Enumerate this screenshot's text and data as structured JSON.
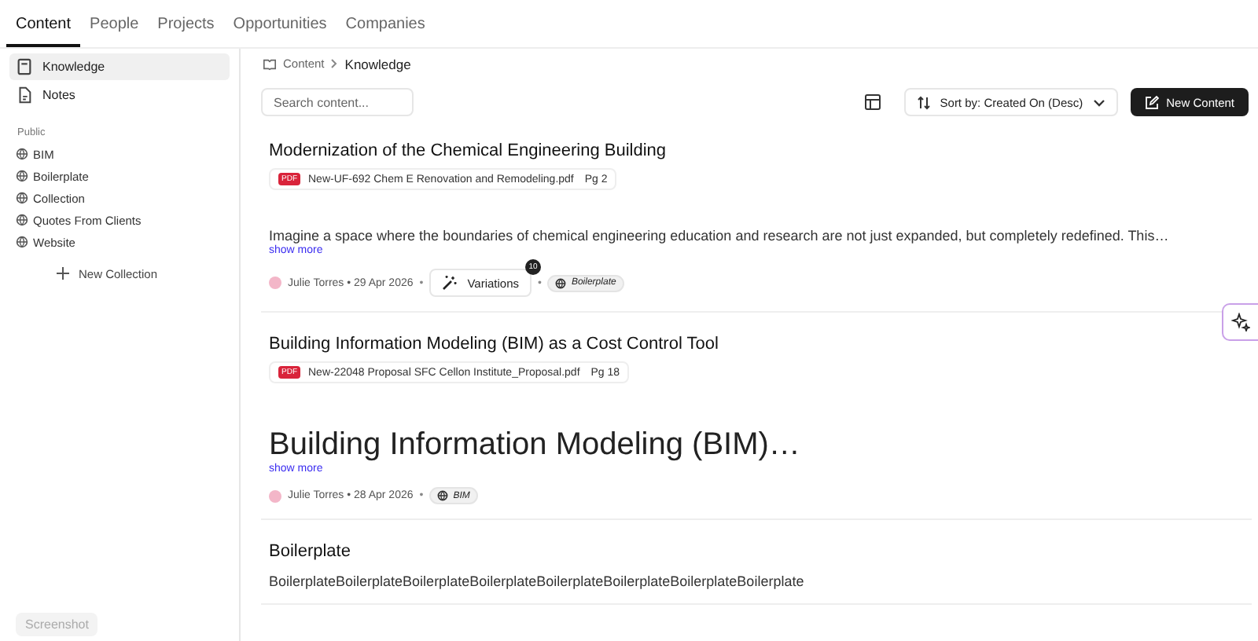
{
  "tabs": [
    {
      "label": "Content",
      "selected": true
    },
    {
      "label": "People",
      "selected": false
    },
    {
      "label": "Projects",
      "selected": false
    },
    {
      "label": "Opportunities",
      "selected": false
    },
    {
      "label": "Companies",
      "selected": false
    }
  ],
  "sidebar": {
    "items": [
      {
        "label": "Knowledge",
        "selected": true
      },
      {
        "label": "Notes",
        "selected": false
      }
    ],
    "section_label": "Public",
    "collections": [
      "BIM",
      "Boilerplate",
      "Collection",
      "Quotes From Clients",
      "Website"
    ],
    "new_collection": "New Collection",
    "screenshot_button": "Screenshot"
  },
  "breadcrumb": [
    "Content",
    "Knowledge"
  ],
  "search": {
    "placeholder": "Search content..."
  },
  "sort": {
    "label": "Sort by: Created On (Desc)"
  },
  "new_button": "New Content",
  "items": [
    {
      "title": "Modernization of the Chemical Engineering Building",
      "file": {
        "badge": "PDF",
        "name": "New-UF-692 Chem E Renovation and Remodeling.pdf",
        "page": "Pg 2"
      },
      "kind": "paragraph",
      "body": "Imagine a space where the boundaries of chemical engineering education and research are not just expanded, but completely redefined. This…",
      "show_more": "show more",
      "meta": {
        "author": "Julie Torres",
        "separator": "•",
        "date": "29 Apr 2026",
        "variations": {
          "label": "Variations",
          "count": "10"
        },
        "tag": "Boilerplate"
      }
    },
    {
      "title": "Building Information Modeling (BIM) as a Cost Control Tool",
      "file": {
        "badge": "PDF",
        "name": "New-22048 Proposal SFC Cellon Institute_Proposal.pdf",
        "page": "Pg 18"
      },
      "kind": "heading",
      "body": "Building Information Modeling (BIM)…",
      "show_more": "show more",
      "meta": {
        "author": "Julie Torres",
        "separator": "•",
        "date": "28 Apr 2026",
        "tag": "BIM"
      }
    },
    {
      "title": "Boilerplate",
      "kind": "paragraph",
      "body": "BoilerplateBoilerplateBoilerplateBoilerplateBoilerplateBoilerplateBoilerplateBoilerplate"
    }
  ]
}
